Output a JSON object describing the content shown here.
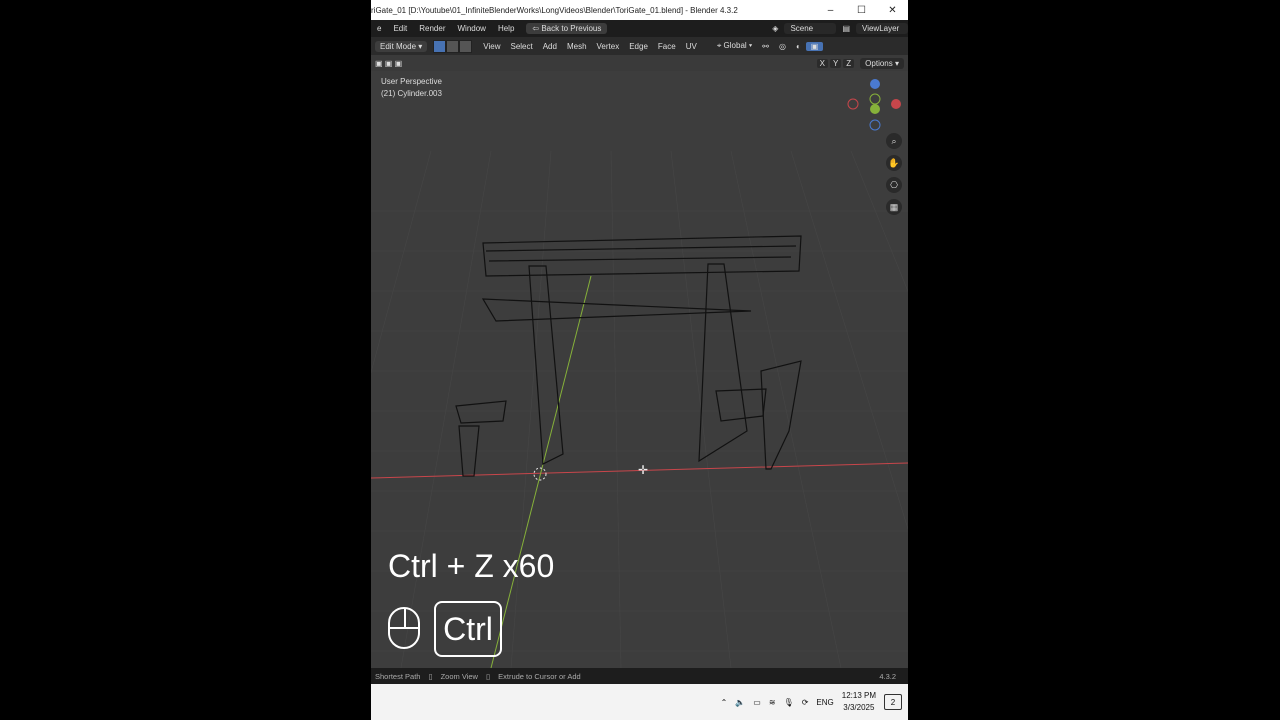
{
  "window": {
    "title": "riGate_01 [D:\\Youtube\\01_InfiniteBlenderWorks\\LongVideos\\Blender\\ToriGate_01.blend] - Blender 4.3.2",
    "controls": [
      "–",
      "☐",
      "✕"
    ]
  },
  "menubar": {
    "items": [
      "e",
      "Edit",
      "Render",
      "Window",
      "Help"
    ],
    "back_label": "Back to Previous",
    "scene_label": "Scene",
    "viewlayer_label": "ViewLayer"
  },
  "header": {
    "mode_label": "Edit Mode",
    "menu_items": [
      "View",
      "Select",
      "Add",
      "Mesh",
      "Vertex",
      "Edge",
      "Face",
      "UV"
    ],
    "orientation_label": "Global",
    "axes": [
      "X",
      "Y",
      "Z"
    ],
    "options_label": "Options"
  },
  "viewport": {
    "perspective_label": "User Perspective",
    "object_label": "(21) Cylinder.003",
    "gizmo_axes": [
      "X",
      "Y",
      "Z"
    ]
  },
  "overlay": {
    "shortcut_text": "Ctrl + Z x60",
    "key_label": "Ctrl"
  },
  "statusbar": {
    "items": [
      "Shortest Path",
      "Zoom View",
      "Extrude to Cursor or Add"
    ],
    "version": "4.3.2"
  },
  "taskbar": {
    "lang": "ENG",
    "time": "12:13 PM",
    "date": "3/3/2025",
    "notification_count": "2"
  },
  "colors": {
    "x_axis": "#c8464b",
    "y_axis": "#86b13a",
    "z_axis": "#4a7ad1",
    "active_blue": "#4772b3"
  }
}
